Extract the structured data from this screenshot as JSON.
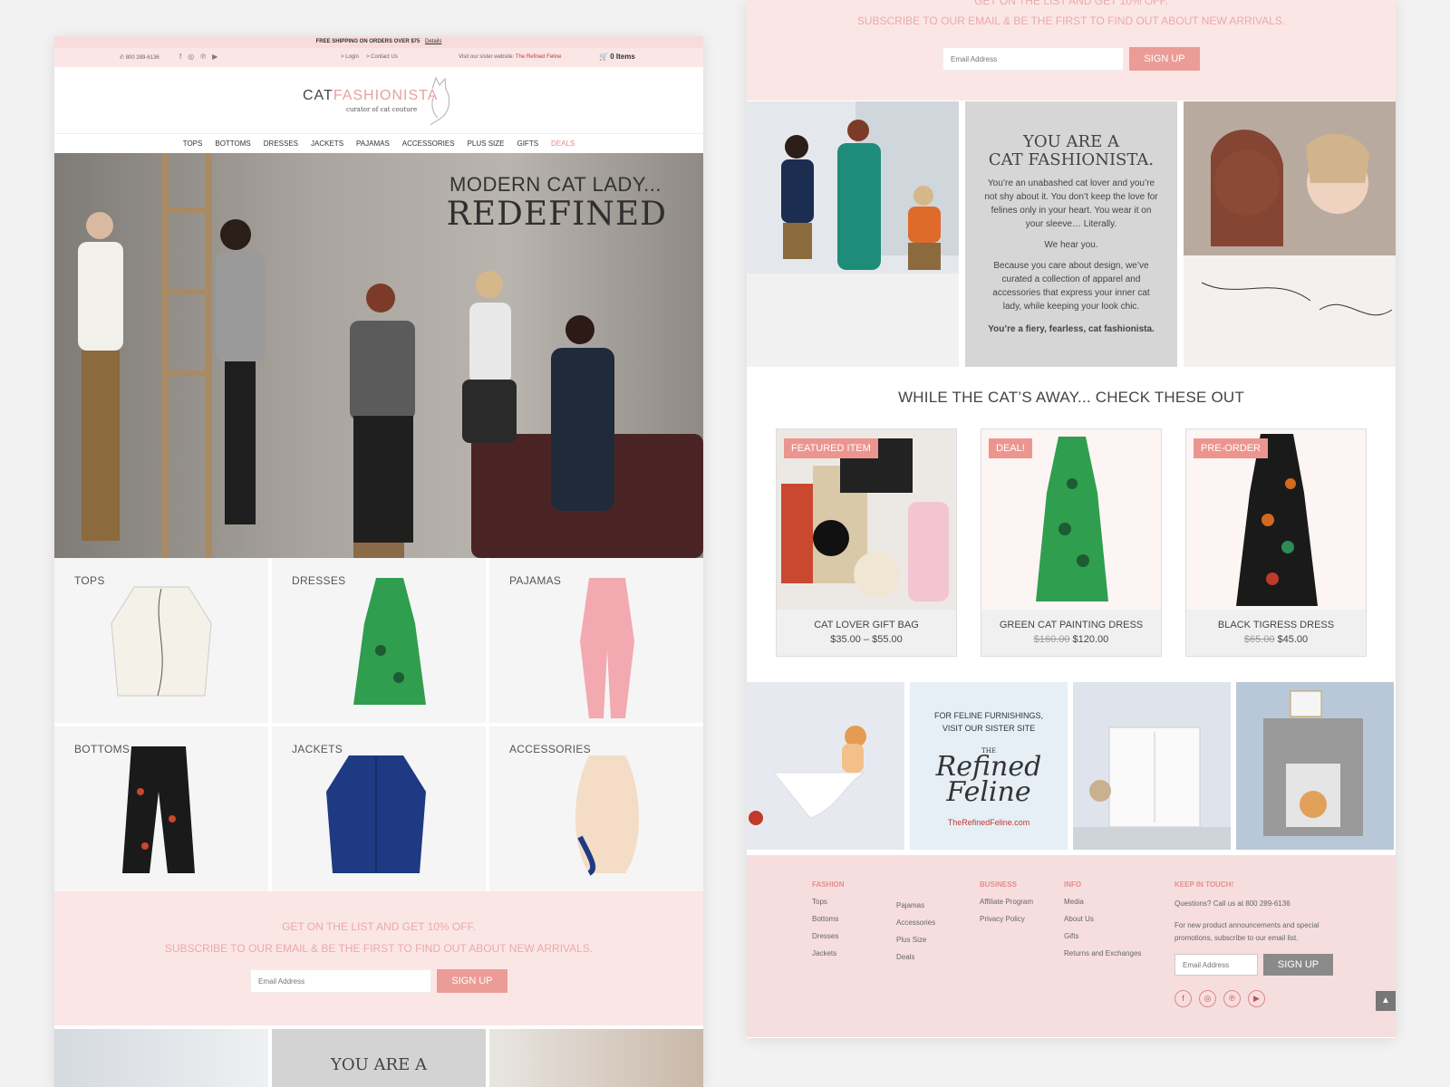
{
  "topbar": {
    "shipping": "FREE SHIPPING ON ORDERS OVER $75",
    "details": "Details"
  },
  "utility": {
    "phone": "800 289-6136",
    "social_icons": [
      "facebook-icon",
      "instagram-icon",
      "pinterest-icon",
      "youtube-icon"
    ],
    "login": "> Login",
    "contact": "> Contact Us",
    "sister_prefix": "Visit our sister website:",
    "sister_link": "The Refined Feline",
    "cart": "0 Items"
  },
  "logo": {
    "cat": "CAT",
    "fashionista": "FASHIONISTA",
    "tagline": "curator of cat couture"
  },
  "nav": [
    "TOPS",
    "BOTTOMS",
    "DRESSES",
    "JACKETS",
    "PAJAMAS",
    "ACCESSORIES",
    "PLUS SIZE",
    "GIFTS",
    "DEALS"
  ],
  "hero": {
    "line1": "MODERN CAT LADY...",
    "line2": "REDEFINED"
  },
  "categories": [
    "TOPS",
    "DRESSES",
    "PAJAMAS",
    "BOTTOMS",
    "JACKETS",
    "ACCESSORIES"
  ],
  "signup": {
    "line1": "GET ON THE LIST AND GET 10% OFF.",
    "line2": "SUBSCRIBE TO OUR EMAIL & BE THE FIRST TO FIND OUT ABOUT NEW ARRIVALS.",
    "placeholder": "Email Address",
    "button": "SIGN UP",
    "right_line1": "GET ON THE LIST AND GET 10% OFF."
  },
  "about": {
    "title1": "YOU ARE A",
    "title2": "CAT FASHIONISTA.",
    "p1": "You’re an unabashed cat lover and you’re not shy about it. You don’t keep the love for felines only in your heart. You wear it on your sleeve… Literally.",
    "p2": "We hear you.",
    "p3": "Because you care about design, we’ve curated a collection of apparel and accessories that express your inner cat lady, while keeping your look chic.",
    "p4": "You’re a fiery, fearless, cat fashionista."
  },
  "featured": {
    "heading": "WHILE THE CAT’S AWAY... CHECK THESE OUT",
    "products": [
      {
        "badge": "FEATURED ITEM",
        "name": "CAT LOVER GIFT BAG",
        "old_price": "",
        "price": "$35.00 – $55.00"
      },
      {
        "badge": "DEAL!",
        "name": "GREEN CAT PAINTING DRESS",
        "old_price": "$160.00",
        "price": "$120.00"
      },
      {
        "badge": "PRE-ORDER",
        "name": "BLACK TIGRESS DRESS",
        "old_price": "$65.00",
        "price": "$45.00"
      }
    ]
  },
  "sister": {
    "line1": "FOR FELINE FURNISHINGS,",
    "line2": "VISIT OUR SISTER SITE",
    "logo_the": "THE",
    "logo_refined": "Refined",
    "logo_feline": "Feline",
    "url": "TheRefinedFeline.com"
  },
  "footer": {
    "fashion_heading": "FASHION",
    "fashion_col1": [
      "Tops",
      "Bottoms",
      "Dresses",
      "Jackets"
    ],
    "fashion_col2": [
      "Pajamas",
      "Accessories",
      "Plus Size",
      "Deals"
    ],
    "business_heading": "BUSINESS",
    "business_items": [
      "Affiliate Program",
      "Privacy Policy"
    ],
    "info_heading": "INFO",
    "info_items": [
      "Media",
      "About Us",
      "Gifts",
      "Returns and Exchanges"
    ],
    "keep_heading": "KEEP IN TOUCH!",
    "keep_phone": "Questions? Call us at 800 289-6136",
    "keep_text": "For new product announcements and special promotions, subscribe to our email list.",
    "placeholder": "Email Address",
    "button": "SIGN UP",
    "social_icons": [
      "facebook-icon",
      "instagram-icon",
      "pinterest-icon",
      "youtube-icon"
    ]
  },
  "colors": {
    "accent": "#eb9c96",
    "pink_bg": "#fbe6e6",
    "deals": "#e9868a",
    "footer_bg": "#f6dede"
  }
}
